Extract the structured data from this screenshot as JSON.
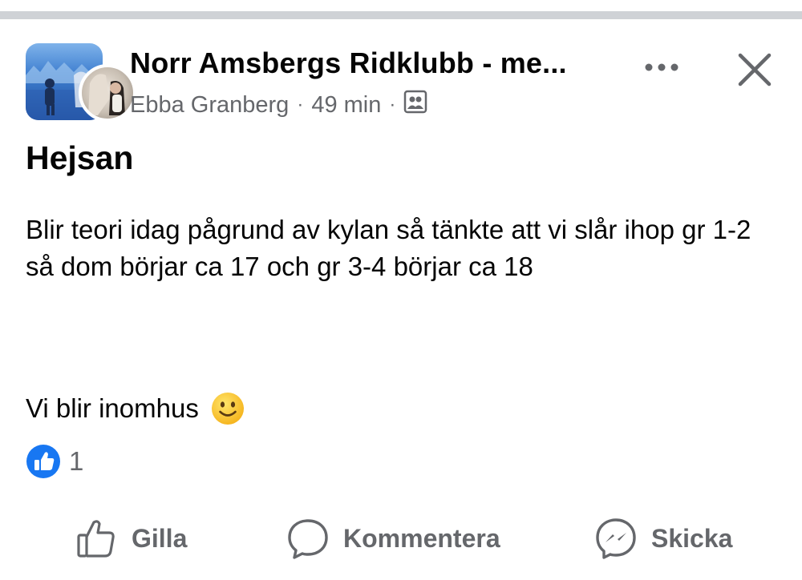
{
  "post": {
    "group_name": "Norr Amsbergs Ridklubb - me...",
    "author": "Ebba Granberg",
    "separator": "·",
    "time": "49 min",
    "audience_icon": "group-members-icon",
    "title": "Hejsan",
    "body": "Blir teori idag pågrund av kylan så tänkte att vi slår ihop gr 1-2 så dom börjar ca 17 och gr 3-4 börjar ca 18",
    "closing": "Vi blir inomhus",
    "closing_emoji": "slightly-smiling-face-icon"
  },
  "reactions": {
    "icon": "like-icon",
    "count": "1"
  },
  "actions": [
    {
      "label": "Gilla",
      "icon": "thumbs-up-icon"
    },
    {
      "label": "Kommentera",
      "icon": "comment-icon"
    },
    {
      "label": "Skicka",
      "icon": "messenger-icon"
    }
  ],
  "colors": {
    "text": "#050505",
    "secondary_text": "#65676b",
    "like_blue": "#1877f2",
    "top_bar": "#cfd2d6"
  }
}
